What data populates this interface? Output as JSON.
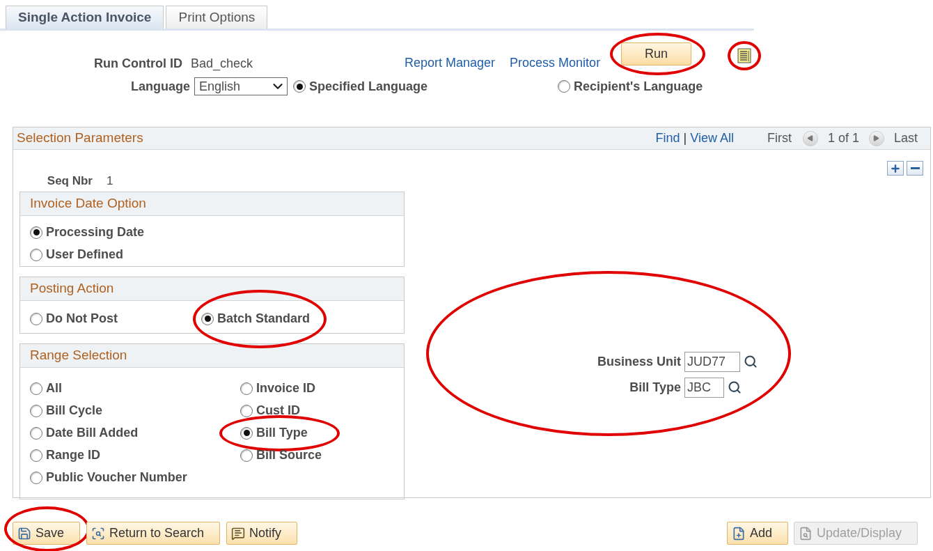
{
  "tabs": [
    {
      "label": "Single Action Invoice",
      "selected": true
    },
    {
      "label": "Print Options",
      "selected": false
    }
  ],
  "run_control": {
    "label": "Run Control ID",
    "value": "Bad_check"
  },
  "language": {
    "label": "Language",
    "value": "English"
  },
  "language_options": [
    {
      "label": "Specified Language",
      "selected": true
    },
    {
      "label": "Recipient's Language",
      "selected": false
    }
  ],
  "links": [
    "Report Manager",
    "Process Monitor"
  ],
  "run_button": {
    "label": "Run",
    "circled": true
  },
  "report_icon": {
    "circled": true
  },
  "selection": {
    "title": "Selection Parameters",
    "find": "Find",
    "separator": "|",
    "view_all": "View All",
    "first": "First",
    "count": "1 of 1",
    "last": "Last",
    "seq_label": "Seq Nbr",
    "seq_value": "1"
  },
  "groups": [
    {
      "title": "Invoice Date Option",
      "kind": "single",
      "options": [
        {
          "label": "Processing Date",
          "selected": true,
          "circled": false
        },
        {
          "label": "User Defined",
          "selected": false,
          "circled": false
        }
      ]
    },
    {
      "title": "Posting Action",
      "kind": "pair",
      "options": [
        {
          "label": "Do Not Post",
          "selected": false,
          "circled": false
        },
        {
          "label": "Batch Standard",
          "selected": true,
          "circled": true
        }
      ]
    },
    {
      "title": "Range Selection",
      "kind": "grid",
      "options": [
        {
          "label": "All",
          "selected": false,
          "circled": false
        },
        {
          "label": "Invoice ID",
          "selected": false,
          "circled": false
        },
        {
          "label": "Bill Cycle",
          "selected": false,
          "circled": false
        },
        {
          "label": "Cust ID",
          "selected": false,
          "circled": false
        },
        {
          "label": "Date Bill Added",
          "selected": false,
          "circled": false
        },
        {
          "label": "Bill Type",
          "selected": true,
          "circled": true
        },
        {
          "label": "Range ID",
          "selected": false,
          "circled": false
        },
        {
          "label": "Bill Source",
          "selected": false,
          "circled": false
        },
        {
          "label": "Public Voucher Number",
          "selected": false,
          "circled": false
        }
      ]
    }
  ],
  "fields": {
    "circled": true,
    "items": [
      {
        "label": "Business Unit",
        "value": "JUD77"
      },
      {
        "label": "Bill Type",
        "value": "JBC"
      }
    ]
  },
  "toolbar_left": [
    {
      "label": "Save",
      "kind": "save",
      "circled": true,
      "disabled": false
    },
    {
      "label": "Return to Search",
      "kind": "return",
      "circled": false,
      "disabled": false
    },
    {
      "label": "Notify",
      "kind": "notify",
      "circled": false,
      "disabled": false
    }
  ],
  "toolbar_right": [
    {
      "label": "Add",
      "kind": "add",
      "circled": false,
      "disabled": false
    },
    {
      "label": "Update/Display",
      "kind": "update",
      "circled": false,
      "disabled": true
    }
  ]
}
